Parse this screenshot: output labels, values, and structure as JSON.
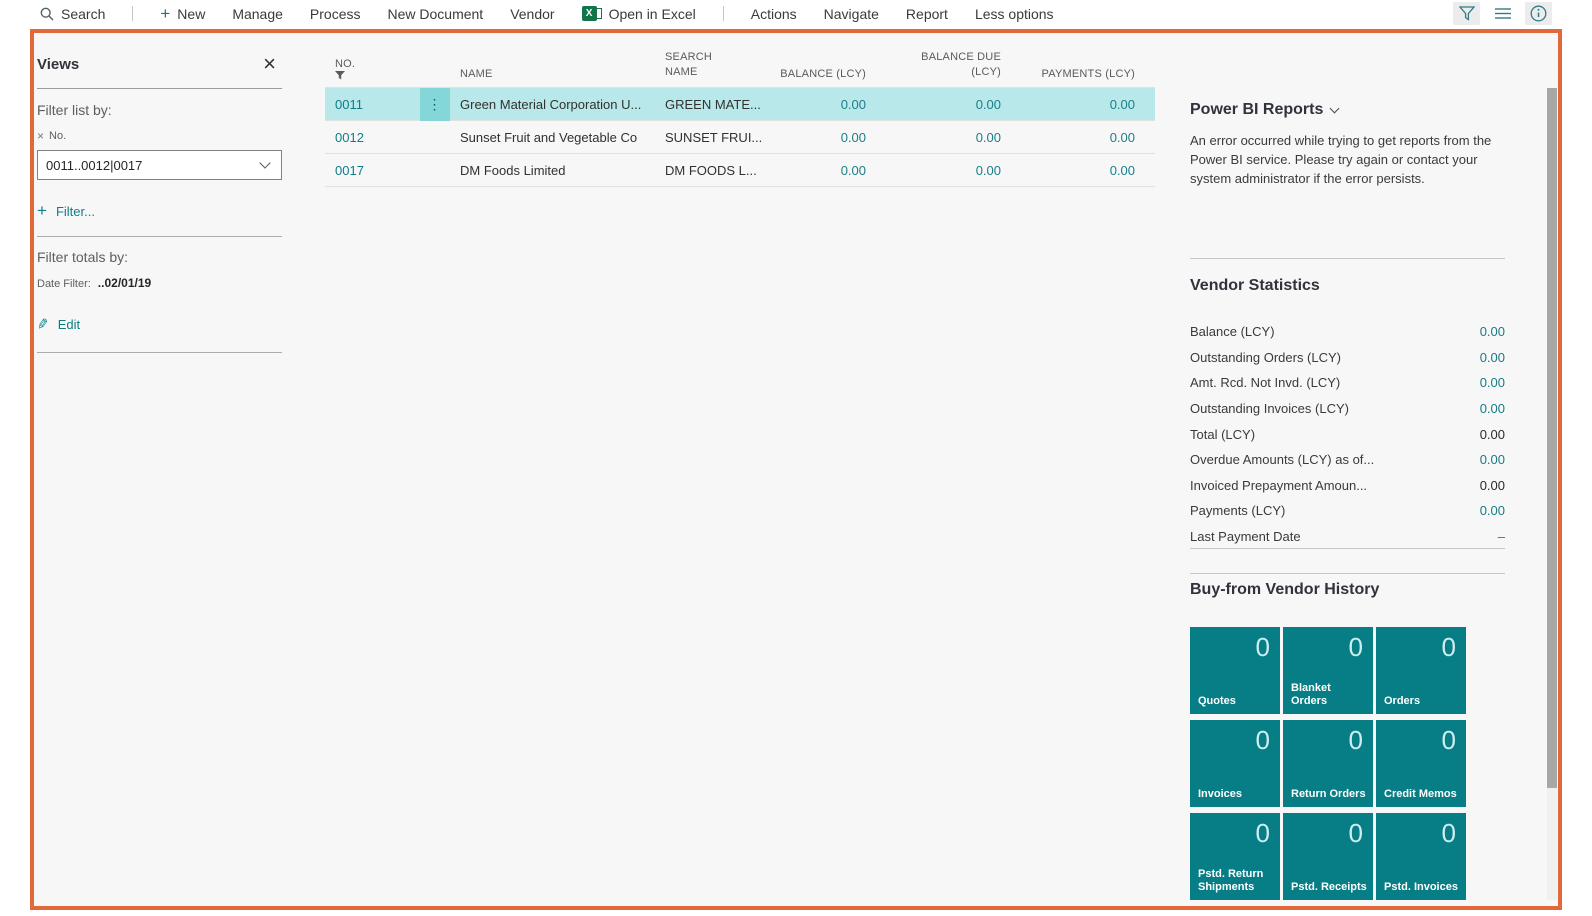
{
  "toolbar": {
    "search": "Search",
    "new": "New",
    "manage": "Manage",
    "process": "Process",
    "new_document": "New Document",
    "vendor": "Vendor",
    "open_in_excel": "Open in Excel",
    "excel_x": "X",
    "actions": "Actions",
    "navigate": "Navigate",
    "report": "Report",
    "less_options": "Less options"
  },
  "filter_pane": {
    "title": "Views",
    "filter_list_by": "Filter list by:",
    "remove_filter_glyph": "×",
    "field_label": "No.",
    "filter_value": "0011..0012|0017",
    "add_filter": "Filter...",
    "plus_glyph": "+",
    "filter_totals_by": "Filter totals by:",
    "date_filter_label": "Date Filter:",
    "date_filter_value": "..02/01/19",
    "edit": "Edit",
    "pencil_glyph": "✎",
    "close_glyph": "×"
  },
  "table": {
    "columns": {
      "no": "NO.",
      "name": "NAME",
      "search_name": "SEARCH NAME",
      "balance": "BALANCE (LCY)",
      "balance_due": "BALANCE DUE (LCY)",
      "payments": "PAYMENTS (LCY)"
    },
    "row_menu_glyph": "⋮",
    "rows": [
      {
        "no": "0011",
        "name": "Green Material Corporation U...",
        "search_name": "GREEN MATE...",
        "balance": "0.00",
        "balance_due": "0.00",
        "payments": "0.00",
        "selected": true
      },
      {
        "no": "0012",
        "name": "Sunset Fruit and Vegetable Co",
        "search_name": "SUNSET FRUI...",
        "balance": "0.00",
        "balance_due": "0.00",
        "payments": "0.00",
        "selected": false
      },
      {
        "no": "0017",
        "name": "DM Foods Limited",
        "search_name": "DM FOODS L...",
        "balance": "0.00",
        "balance_due": "0.00",
        "payments": "0.00",
        "selected": false
      }
    ]
  },
  "power_bi": {
    "title": "Power BI Reports",
    "error": "An error occurred while trying to get reports from the Power BI service. Please try again or contact your system administrator if the error persists."
  },
  "vendor_statistics": {
    "title": "Vendor Statistics",
    "rows": [
      {
        "label": "Balance (LCY)",
        "value": "0.00"
      },
      {
        "label": "Outstanding Orders (LCY)",
        "value": "0.00"
      },
      {
        "label": "Amt. Rcd. Not Invd. (LCY)",
        "value": "0.00"
      },
      {
        "label": "Outstanding Invoices (LCY)",
        "value": "0.00"
      },
      {
        "label": "Total (LCY)",
        "value": "0.00"
      },
      {
        "label": "Overdue Amounts (LCY) as of...",
        "value": "0.00"
      },
      {
        "label": "Invoiced Prepayment Amoun...",
        "value": "0.00"
      },
      {
        "label": "Payments (LCY)",
        "value": "0.00"
      },
      {
        "label": "Last Payment Date",
        "value": "–"
      }
    ]
  },
  "vendor_history": {
    "title": "Buy-from Vendor History",
    "tiles": [
      {
        "label": "Quotes",
        "value": "0"
      },
      {
        "label": "Blanket Orders",
        "value": "0"
      },
      {
        "label": "Orders",
        "value": "0"
      },
      {
        "label": "Invoices",
        "value": "0"
      },
      {
        "label": "Return Orders",
        "value": "0"
      },
      {
        "label": "Credit Memos",
        "value": "0"
      },
      {
        "label": "Pstd. Return Shipments",
        "value": "0"
      },
      {
        "label": "Pstd. Receipts",
        "value": "0"
      },
      {
        "label": "Pstd. Invoices",
        "value": "0"
      }
    ]
  },
  "colors": {
    "accent_teal": "#0e7d87",
    "tile_teal": "#077d85",
    "selected_row": "#b9e8ea",
    "selected_menu_cell": "#85d6d9",
    "focus_frame_orange": "#e2683b",
    "page_background": "#f7f7f7",
    "excel_green": "#13734b"
  }
}
